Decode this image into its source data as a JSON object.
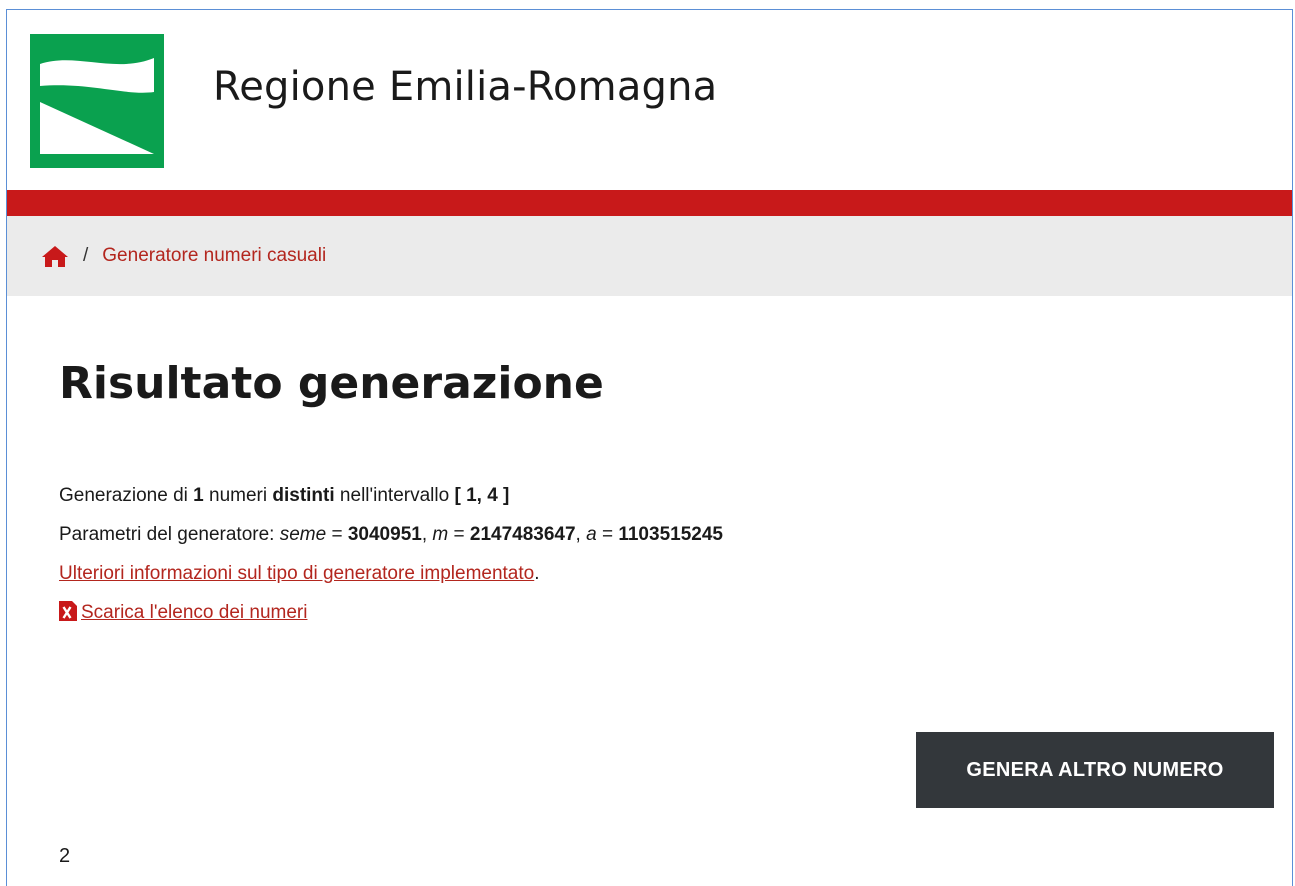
{
  "site": {
    "title": "Regione Emilia-Romagna",
    "brand_green": "#0aa14f",
    "brand_red": "#c8191a"
  },
  "breadcrumb": {
    "home_icon": "home-icon",
    "separator": "/",
    "current": "Generatore numeri casuali"
  },
  "page": {
    "title": "Risultato generazione"
  },
  "generation": {
    "line1_prefix": "Generazione di ",
    "count": "1",
    "line1_mid1": " numeri ",
    "distinct": "distinti",
    "line1_mid2": " nell'intervallo ",
    "interval": "[ 1, 4 ]",
    "line2_prefix": "Parametri del generatore: ",
    "seme_label": "seme",
    "eq": " = ",
    "seme_value": "3040951",
    "comma": ", ",
    "m_label": "m",
    "m_value": "2147483647",
    "a_label": "a",
    "a_value": "1103515245",
    "info_link": "Ulteriori informazioni sul tipo di generatore implementato",
    "info_link_suffix": ".",
    "download_icon": "excel-file-icon",
    "download_link": "Scarica l'elenco dei numeri"
  },
  "actions": {
    "generate_again": "GENERA ALTRO NUMERO"
  },
  "results": {
    "numbers": "2"
  }
}
